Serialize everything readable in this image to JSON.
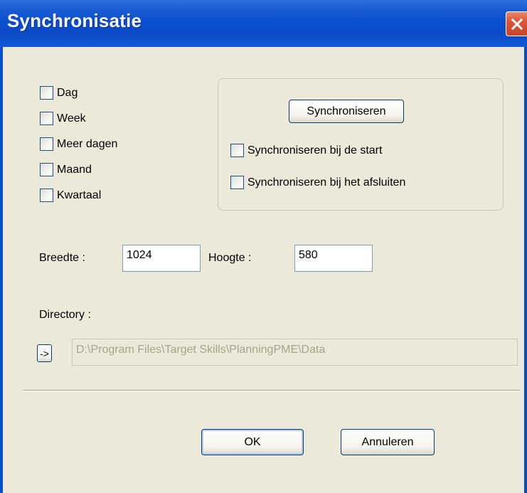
{
  "window": {
    "title": "Synchronisatie",
    "close_icon": "close-icon",
    "title_bar_color": "#0A4BC6",
    "close_button_color": "#D8573A"
  },
  "periods": [
    {
      "label": "Dag",
      "checked": false
    },
    {
      "label": "Week",
      "checked": false
    },
    {
      "label": "Meer dagen",
      "checked": false
    },
    {
      "label": "Maand",
      "checked": false
    },
    {
      "label": "Kwartaal",
      "checked": false
    }
  ],
  "sync": {
    "button_label": "Synchroniseren",
    "on_start_label": "Synchroniseren bij de start",
    "on_start_checked": false,
    "on_close_label": "Synchroniseren bij het afsluiten",
    "on_close_checked": false
  },
  "size": {
    "width_label": "Breedte :",
    "width_value": "1024",
    "height_label": "Hoogte :",
    "height_value": "580"
  },
  "directory": {
    "label": "Directory :",
    "browse_label": "->",
    "path": "D:\\Program Files\\Target Skills\\PlanningPME\\Data"
  },
  "footer": {
    "ok_label": "OK",
    "cancel_label": "Annuleren"
  }
}
